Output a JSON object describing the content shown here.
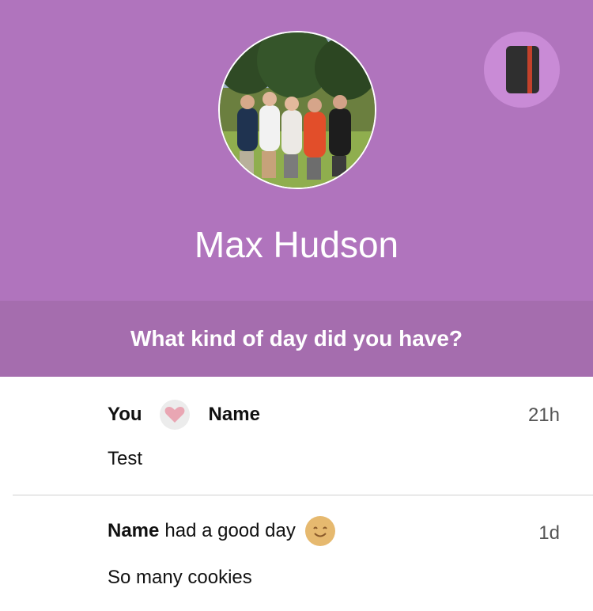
{
  "profile": {
    "name": "Max Hudson",
    "avatar_alt": "group photo",
    "journal_icon": "notebook-icon"
  },
  "prompt": {
    "text": "What kind of day did you have?"
  },
  "feed": [
    {
      "actor": "You",
      "reaction_icon": "heart-icon",
      "target": "Name",
      "time": "21h",
      "body": "Test"
    },
    {
      "actor": "Name",
      "action": "had a good day",
      "mood_icon": "smile-icon",
      "time": "1d",
      "body": "So many cookies"
    }
  ],
  "colors": {
    "header_bg": "#b074bd",
    "prompt_bg": "#a56dae",
    "journal_button_bg": "#c98bd6",
    "heart": "#e9a6b3",
    "smile": "#e6b96f"
  }
}
